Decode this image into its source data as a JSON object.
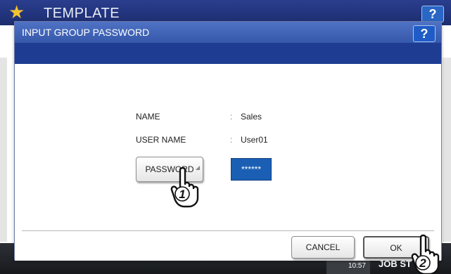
{
  "background": {
    "title": "TEMPLATE",
    "help_label": "?",
    "time_line1": "— — —",
    "time_line2": "10:57",
    "job_label": "JOB ST"
  },
  "dialog": {
    "title": "INPUT GROUP PASSWORD",
    "help_label": "?",
    "fields": [
      {
        "label": "NAME",
        "value": "Sales"
      },
      {
        "label": "USER NAME",
        "value": "User01"
      }
    ],
    "password_button_label": "PASSWORD",
    "password_value": "******",
    "cancel_label": "CANCEL",
    "ok_label": "OK"
  },
  "callouts": {
    "step1": "1",
    "step2": "2"
  },
  "colors": {
    "titlebar": "#2a3e8e",
    "dialog_title": "#3f63b8",
    "dialog_band": "#1f3c93",
    "password_field": "#1a5fb4",
    "star": "#f2c230"
  }
}
